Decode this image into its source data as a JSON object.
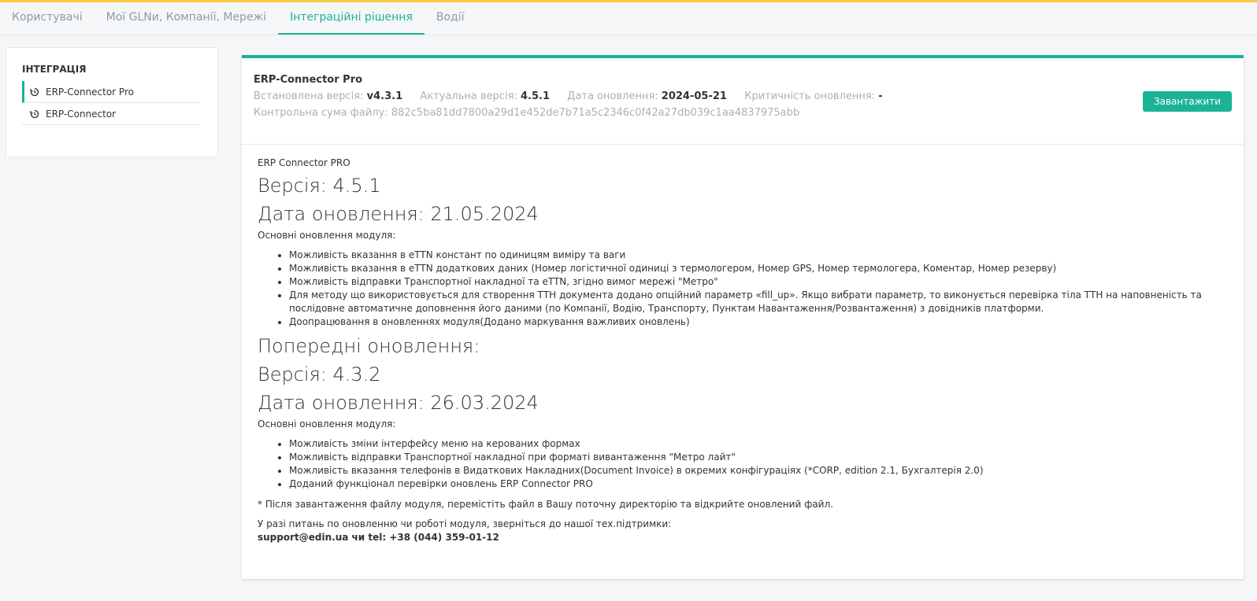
{
  "tabs": [
    {
      "label": "Користувачі"
    },
    {
      "label": "Мої GLNи, Компанії, Мережі"
    },
    {
      "label": "Інтеграційні рішення"
    },
    {
      "label": "Водії"
    }
  ],
  "sidebar": {
    "title": "ІНТЕГРАЦІЯ",
    "items": [
      {
        "label": "ERP-Connector Pro",
        "icon": "history-icon"
      },
      {
        "label": "ERP-Connector",
        "icon": "history-icon"
      }
    ]
  },
  "header": {
    "product": "ERP-Connector Pro",
    "installed_label": "Встановлена версія:",
    "installed_value": "v4.3.1",
    "actual_label": "Актуальна версія:",
    "actual_value": "4.5.1",
    "date_label": "Дата оновлення:",
    "date_value": "2024-05-21",
    "critical_label": "Критичність оновлення:",
    "critical_value": "-",
    "checksum_label": "Контрольна сума файлу:",
    "checksum_value": "882c5ba81dd7800a29d1e452de7b71a5c2346c0f42a27db039c1aa4837975abb",
    "download_label": "Завантажити"
  },
  "body": {
    "intro": "ERP Connector PRO",
    "version1": "Версія: 4.5.1",
    "date1": "Дата оновлення: 21.05.2024",
    "main_updates_label": "Основні оновлення модуля:",
    "updates1": [
      "Можливість вказання в eTTN констант по одиницям виміру та ваги",
      "Можливість вказання в eTTN додаткових даних (Номер логістичної одиниці з термологером, Номер GPS, Номер термологера, Коментар, Номер резерву)",
      "Можливість відправки Транспортної накладної та eTTN, згідно вимог мережі \"Метро\"",
      "Для методу що використовується для створення ТТН документа додано опційний параметр «fill_up». Якщо вибрати параметр, то виконується перевірка тіла ТТН на наповненість та послідовне автоматичне доповнення його даними (по Компанії, Водію, Транспорту, Пунктам Навантаження/Розвантаження) з довідників платформи.",
      "Доопрацювання в оновленнях модуля(Додано маркування важливих оновлень)"
    ],
    "previous_title": "Попередні оновлення:",
    "version2": "Версія: 4.3.2",
    "date2": "Дата оновлення: 26.03.2024",
    "main_updates_label2": "Основні оновлення модуля:",
    "updates2": [
      "Можливість зміни інтерфейсу меню на керованих формах",
      "Можливість відправки Транспортної накладної при форматі вивантаження \"Метро лайт\"",
      "Можливість вказання телефонів в Видаткових Накладних(Document Invoice) в окремих конфігураціях (*CORP, edition 2.1, Бухгалтерія 2.0)",
      "Доданий функціонал перевірки оновлень ERP Connector PRO"
    ],
    "note": "* Після завантаження файлу модуля, перемістіть файл в Вашу поточну директорію та відкрийте оновлений файл.",
    "support_line": "У разі питань по оновленню чи роботі модуля, зверніться до нашої тех.підтримки:",
    "support_contact": "support@edin.ua чи tel: +38 (044) 359-01-12"
  }
}
